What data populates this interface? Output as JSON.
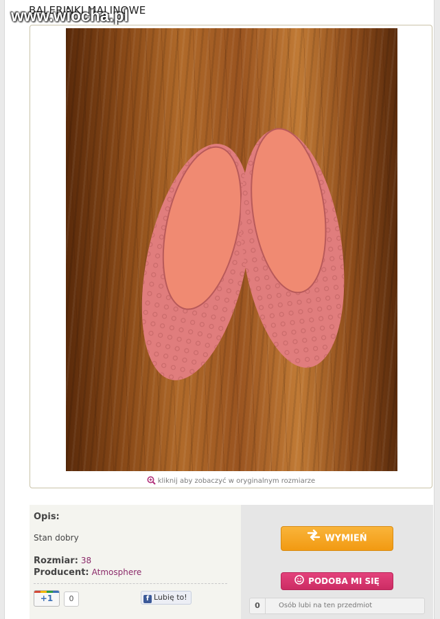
{
  "product": {
    "title": "BALERINKI MALINOWE",
    "watermark": "www.wiocha.pl"
  },
  "photo": {
    "caption": "kliknij aby zobaczyć w oryginalnym rozmiarze",
    "icon": "zoom-in-icon"
  },
  "details": {
    "description_label": "Opis:",
    "description_text": "Stan dobry",
    "size_label": "Rozmiar:",
    "size_value": "38",
    "producer_label": "Producent:",
    "producer_value": "Atmosphere"
  },
  "social": {
    "gplus_label": "+1",
    "gplus_count": "0",
    "fb_label": "Lubię to!"
  },
  "actions": {
    "exchange_label": "WYMIEŃ",
    "like_label": "PODOBA MI SIĘ",
    "likes_count": "0",
    "likes_text": "Osób lubi na ten przedmiot"
  },
  "colors": {
    "exchange_button": "#f29a12",
    "like_button": "#cc2c64",
    "accent_value": "#8b2a6a"
  }
}
